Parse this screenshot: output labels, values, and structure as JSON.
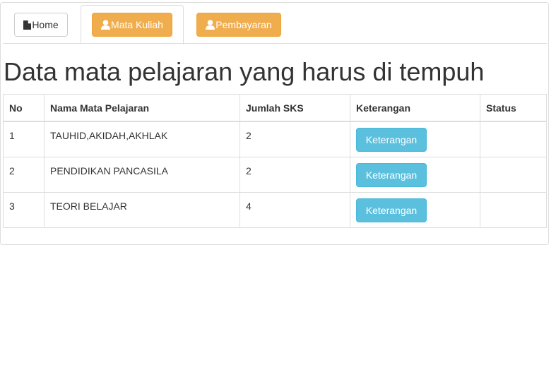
{
  "nav": {
    "home_label": "Home",
    "mata_kuliah_label": "Mata Kuliah",
    "pembayaran_label": "Pembayaran"
  },
  "page": {
    "title": "Data mata pelajaran yang harus di tempuh"
  },
  "table": {
    "headers": {
      "no": "No",
      "nama": "Nama Mata Pelajaran",
      "sks": "Jumlah SKS",
      "keterangan": "Keterangan",
      "status": "Status"
    },
    "rows": [
      {
        "no": "1",
        "nama": "TAUHID,AKIDAH,AKHLAK",
        "sks": "2",
        "button": "Keterangan",
        "status": ""
      },
      {
        "no": "2",
        "nama": "PENDIDIKAN PANCASILA",
        "sks": "2",
        "button": "Keterangan",
        "status": ""
      },
      {
        "no": "3",
        "nama": "TEORI BELAJAR",
        "sks": "4",
        "button": "Keterangan",
        "status": ""
      }
    ]
  },
  "colors": {
    "warning": "#f0ad4e",
    "info": "#5bc0de",
    "border": "#dddddd"
  },
  "icons": {
    "home": "file-icon",
    "mata_kuliah": "user-icon",
    "pembayaran": "user-icon"
  }
}
